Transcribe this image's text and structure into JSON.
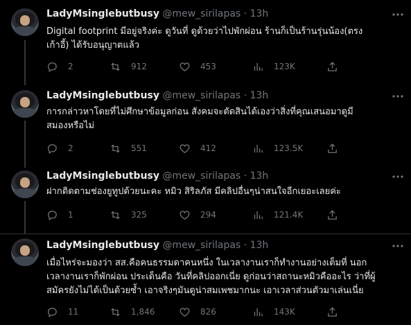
{
  "tweets": [
    {
      "name": "LadyMsinglebutbusy",
      "handle": "@mew_sirilapas",
      "time": "13h",
      "text_lines": [
        "Digital footprint มีอยู่จริงค่ะ ดูวันที่ ดูด้วยว่าไปพักผ่อน ร้านก็เป็นร้านรุ่นน้อง(ตรง",
        "เก้าอี้) ได้รับอนุญาตแล้ว"
      ],
      "replies": "2",
      "retweets": "912",
      "likes": "453",
      "views": "123K"
    },
    {
      "name": "LadyMsinglebutbusy",
      "handle": "@mew_sirilapas",
      "time": "13h",
      "text_lines": [
        "การกล่าวหาโดยที่ไม่ศึกษาข้อมูลก่อน สังคมจะตัดสินได้เองว่าสิ่งที่คุณเสนอมาดูมี",
        "สมองหรือไม่"
      ],
      "replies": "2",
      "retweets": "551",
      "likes": "412",
      "views": "123.5K"
    },
    {
      "name": "LadyMsinglebutbusy",
      "handle": "@mew_sirilapas",
      "time": "13h",
      "text_lines": [
        "ฝากติดตามช่องยูทูปด้วยนะคะ หมิว สิริลภัส มีคลิปอื่นๆน่าสนใจอีกเยอะเลยค่ะ"
      ],
      "replies": "1",
      "retweets": "325",
      "likes": "294",
      "views": "121.4K"
    },
    {
      "name": "LadyMsinglebutbusy",
      "handle": "@mew_sirilapas",
      "time": "13h",
      "text_lines": [
        "เมื่อไหร่จะมองว่า สส.คือคนธรรมดาคนหนึ่ง ในเวลางานเราก็ทำงานอย่างเต็มที่ นอก",
        "เวลางานเราก็พักผ่อน ประเด็นคือ วันที่คลิปออกเนี่ย ดูก่อนว่าสถานะหมิวคืออะไร ว่าที่ผู้",
        "สมัครยังไม่ได้เป็นด้วยซ้ำ เอาจริงๆมันดูน่าสมเพชมากนะ เอาเวลาส่วนตัวมาเล่นเนี่ย"
      ],
      "replies": "11",
      "retweets": "1,846",
      "likes": "826",
      "views": "143K"
    }
  ],
  "separator": "·",
  "icons": [
    "reply-icon",
    "retweet-icon",
    "like-icon",
    "views-icon",
    "share-icon",
    "more-icon"
  ],
  "colors": {
    "background": "#000000",
    "text": "#e7e9ea",
    "muted": "#71767b",
    "line": "#333639"
  }
}
